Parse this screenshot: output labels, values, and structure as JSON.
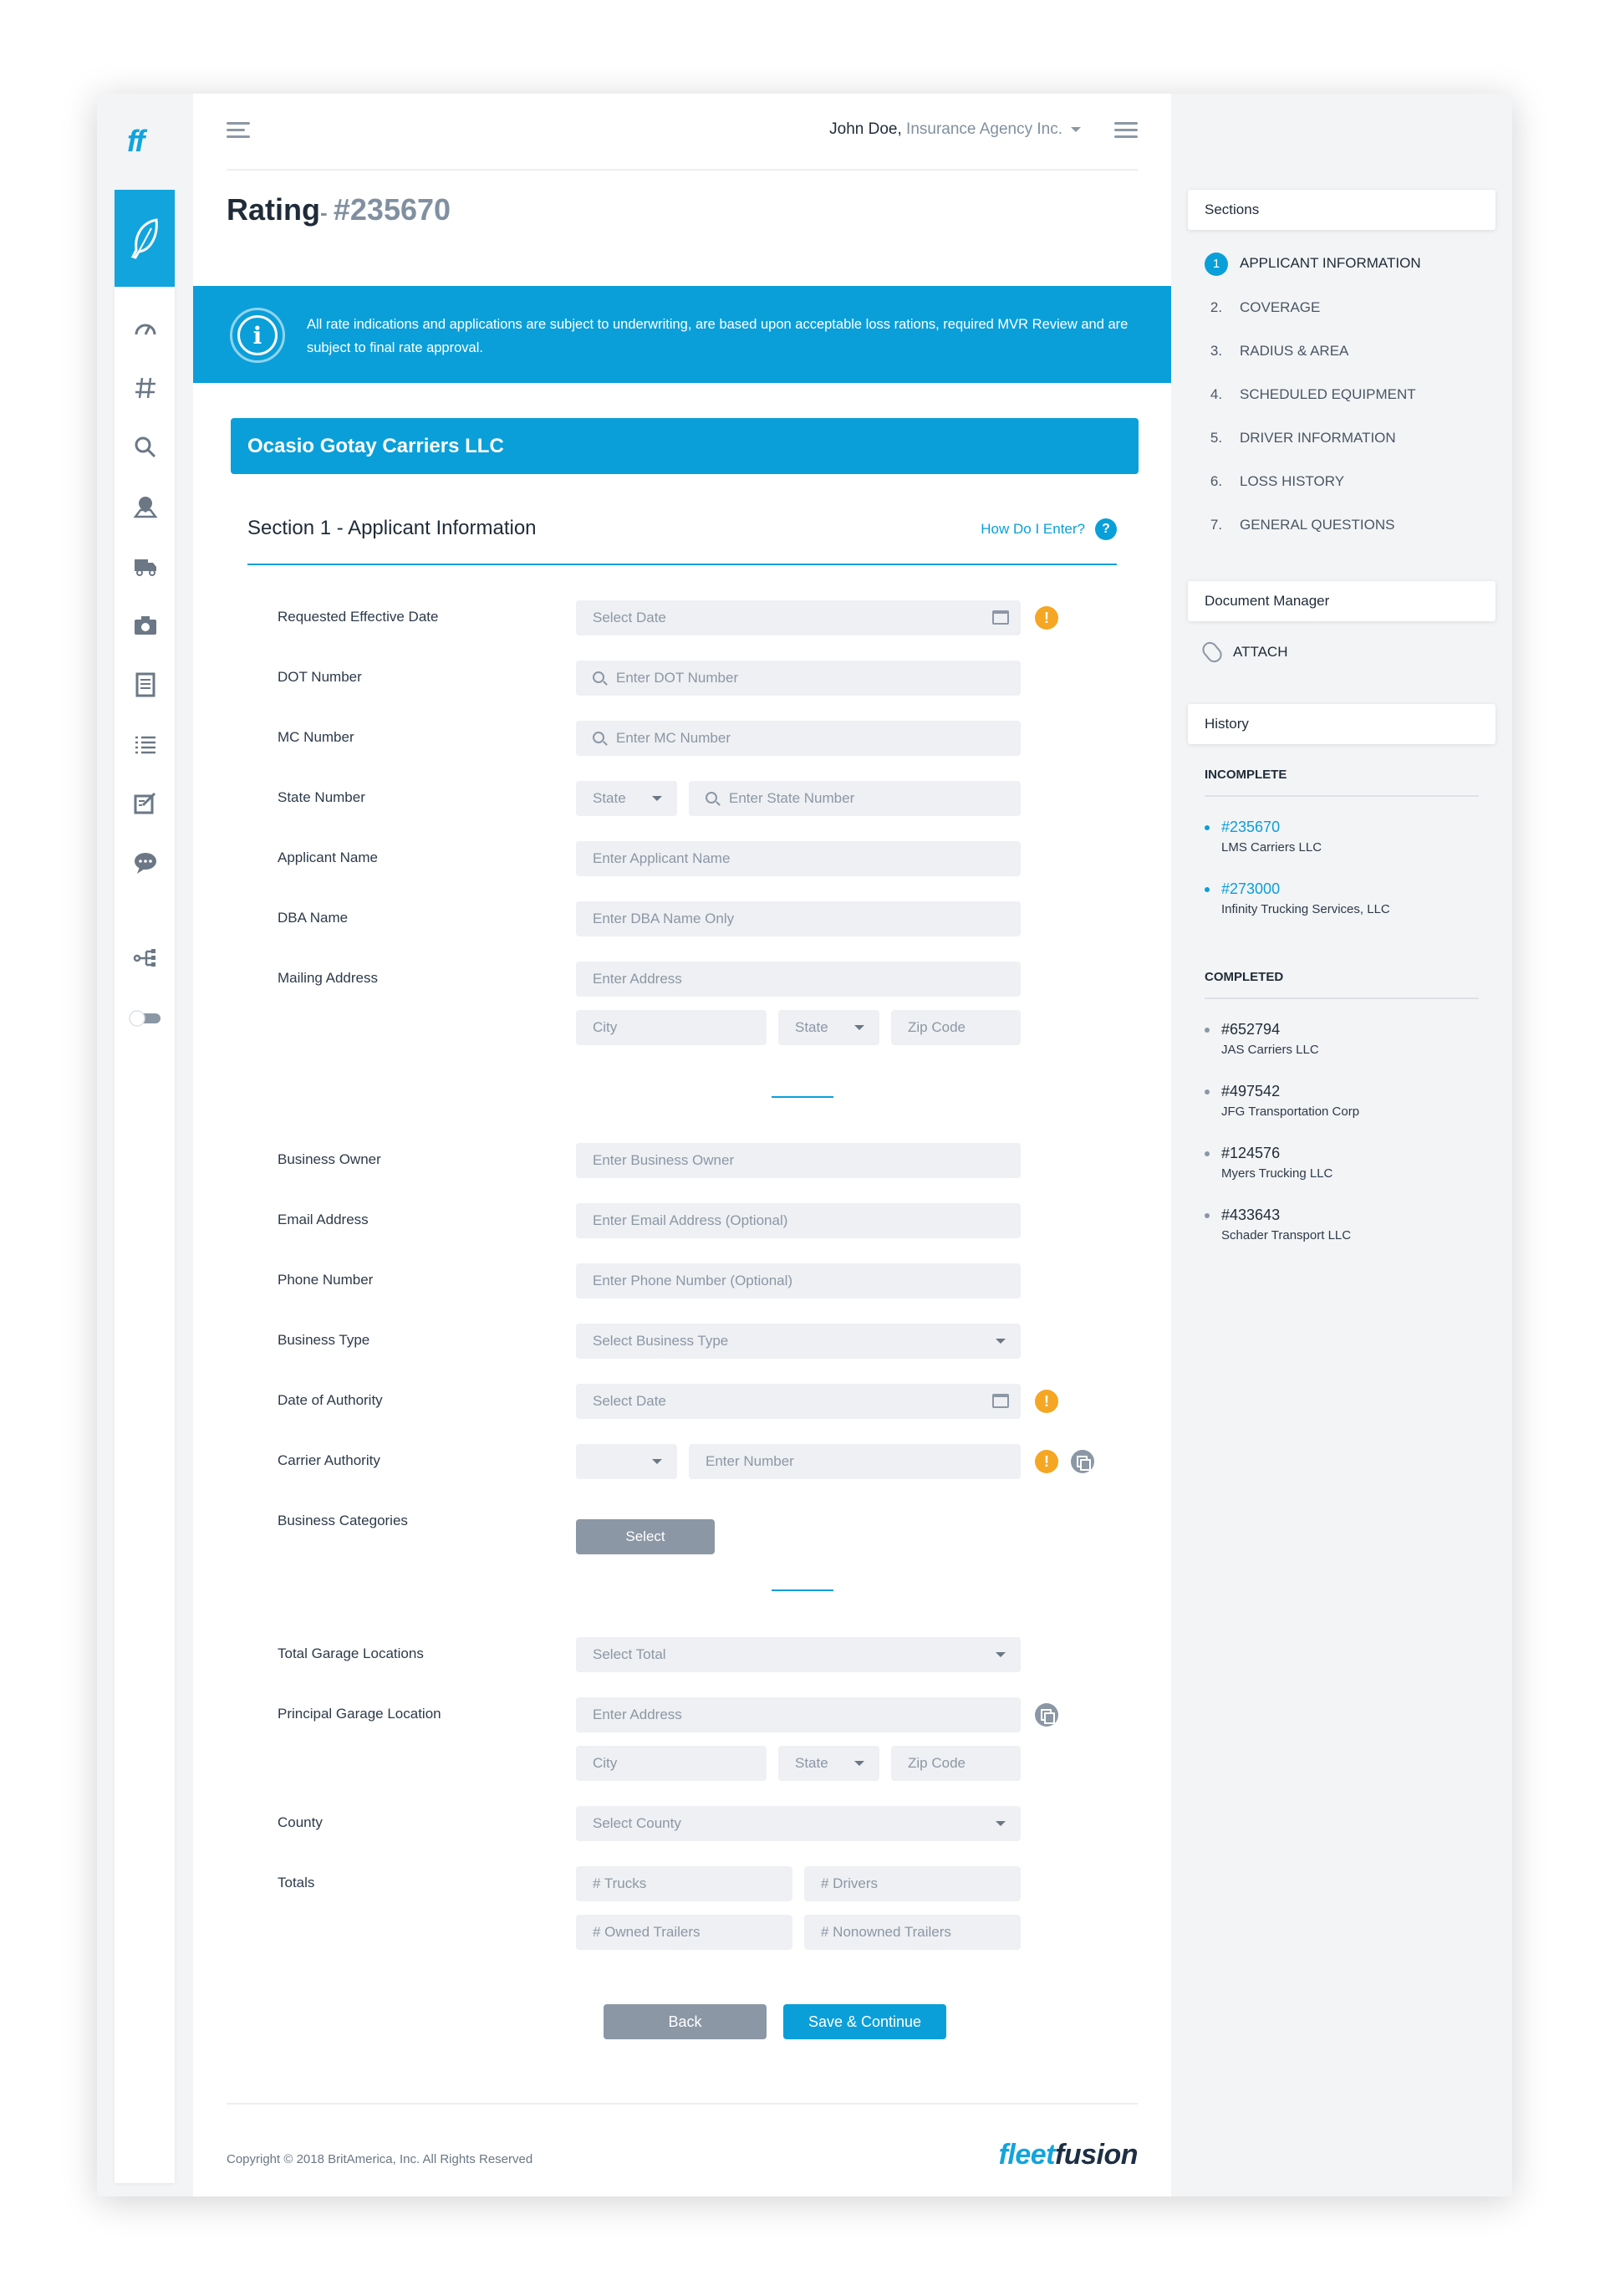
{
  "app": {
    "logo_text": "ff"
  },
  "header": {
    "user_name": "John Doe,",
    "agency": "Insurance Agency Inc."
  },
  "page": {
    "title": "Rating",
    "rating_number": "#235670"
  },
  "banner": {
    "text": "All rate indications and applications are subject to underwriting, are based upon acceptable loss rations, required MVR Review and are subject to final rate approval."
  },
  "company": {
    "name": "Ocasio Gotay Carriers LLC"
  },
  "section": {
    "title": "Section 1 - Applicant Information",
    "help_link": "How Do I Enter?"
  },
  "form": {
    "requested_effective_date": {
      "label": "Requested Effective Date",
      "placeholder": "Select Date"
    },
    "dot_number": {
      "label": "DOT Number",
      "placeholder": "Enter DOT Number"
    },
    "mc_number": {
      "label": "MC Number",
      "placeholder": "Enter MC Number"
    },
    "state_number": {
      "label": "State Number",
      "state_placeholder": "State",
      "placeholder": "Enter State Number"
    },
    "applicant_name": {
      "label": "Applicant Name",
      "placeholder": "Enter Applicant Name"
    },
    "dba_name": {
      "label": "DBA Name",
      "placeholder": "Enter DBA Name Only"
    },
    "mailing_address": {
      "label": "Mailing Address",
      "placeholder": "Enter Address",
      "city": "City",
      "state": "State",
      "zip": "Zip Code"
    },
    "business_owner": {
      "label": "Business Owner",
      "placeholder": "Enter Business Owner"
    },
    "email": {
      "label": "Email Address",
      "placeholder": "Enter Email Address (Optional)"
    },
    "phone": {
      "label": "Phone Number",
      "placeholder": "Enter Phone Number (Optional)"
    },
    "business_type": {
      "label": "Business Type",
      "placeholder": "Select Business Type"
    },
    "date_of_authority": {
      "label": "Date of Authority",
      "placeholder": "Select Date"
    },
    "carrier_authority": {
      "label": "Carrier Authority",
      "placeholder": "Enter Number"
    },
    "business_categories": {
      "label": "Business Categories",
      "button": "Select"
    },
    "total_garage_locations": {
      "label": "Total Garage Locations",
      "placeholder": "Select Total"
    },
    "principal_garage_location": {
      "label": "Principal Garage Location",
      "placeholder": "Enter Address",
      "city": "City",
      "state": "State",
      "zip": "Zip Code"
    },
    "county": {
      "label": "County",
      "placeholder": "Select County"
    },
    "totals": {
      "label": "Totals",
      "trucks": "# Trucks",
      "drivers": "# Drivers",
      "owned_trailers": "# Owned Trailers",
      "nonowned_trailers": "# Nonowned Trailers"
    },
    "warning_symbol": "!"
  },
  "actions": {
    "back": "Back",
    "save": "Save & Continue"
  },
  "footer": {
    "copyright": "Copyright © 2018 BritAmerica, Inc. All Rights Reserved",
    "brand_fleet": "fleet",
    "brand_fusion": "fusion"
  },
  "sidebar": {
    "sections_title": "Sections",
    "sections": [
      {
        "num": "1",
        "label": "APPLICANT INFORMATION"
      },
      {
        "num": "2.",
        "label": "COVERAGE"
      },
      {
        "num": "3.",
        "label": "RADIUS & AREA"
      },
      {
        "num": "4.",
        "label": "SCHEDULED EQUIPMENT"
      },
      {
        "num": "5.",
        "label": "DRIVER INFORMATION"
      },
      {
        "num": "6.",
        "label": "LOSS HISTORY"
      },
      {
        "num": "7.",
        "label": "GENERAL QUESTIONS"
      }
    ],
    "document_manager_title": "Document Manager",
    "attach_label": "ATTACH",
    "history_title": "History",
    "incomplete_label": "INCOMPLETE",
    "incomplete": [
      {
        "id": "#235670",
        "name": "LMS Carriers LLC"
      },
      {
        "id": "#273000",
        "name": "Infinity Trucking Services, LLC"
      }
    ],
    "completed_label": "COMPLETED",
    "completed": [
      {
        "id": "#652794",
        "name": "JAS Carriers LLC"
      },
      {
        "id": "#497542",
        "name": "JFG Transportation Corp"
      },
      {
        "id": "#124576",
        "name": "Myers Trucking LLC"
      },
      {
        "id": "#433643",
        "name": "Schader Transport LLC"
      }
    ]
  },
  "colors": {
    "accent": "#0a9fd9",
    "warning": "#f5a623",
    "muted": "#8c97a5"
  },
  "icons": [
    "feather-icon",
    "speedometer-icon",
    "hashtag-icon",
    "search-icon",
    "map-pin-icon",
    "truck-icon",
    "camera-icon",
    "document-icon",
    "list-icon",
    "edit-icon",
    "chat-icon",
    "hierarchy-icon",
    "toggle-icon"
  ]
}
